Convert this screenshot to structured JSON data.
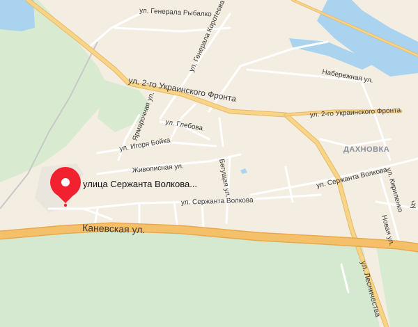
{
  "map": {
    "district": "ДАХНОВКА",
    "streets": {
      "generala_rybalko": "ул. Генерала Рыбалко",
      "generala_korotejeva": "ул. Генерала Коротеева",
      "naberezhnaya": "Набережная ул.",
      "ukr_front_left": "ул. 2-го Украинского Фронта",
      "ukr_front_right": "ул. 2-го Украинского Фронта",
      "yarmarochnaya": "Ярмарочная ул.",
      "glebova": "ул. Глебова",
      "igorya_boika": "ул. Игоря Бойка",
      "zhivopisnaya": "Живописная ул.",
      "begushaya": "Бегущая ул.",
      "serzhanta_volkova_1": "ул. Сержанта Волкова",
      "serzhanta_volkova_2": "ул. Сержанта Волкова",
      "kirilenko": "ул. Кириленко",
      "novaya": "Новая ул.",
      "kanevskaya": "Каневская ул.",
      "lesnichestva": "ул. Лесничества",
      "partial_chu": "Чу"
    },
    "pin": {
      "label": "улица Сержанта Волкова...",
      "color": "#f2212f"
    },
    "colors": {
      "land": "#f4ede2",
      "forest": "#d6ead0",
      "water": "#a9d3ef",
      "major_road": "#f5c97a",
      "minor_road": "#ffffff"
    }
  }
}
